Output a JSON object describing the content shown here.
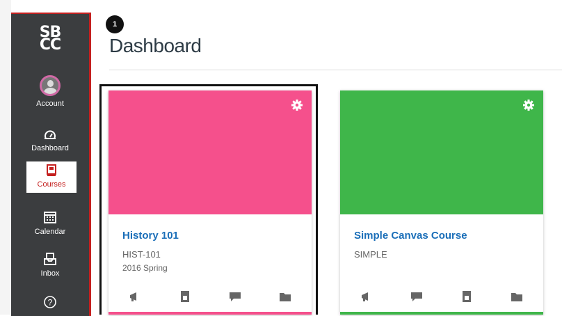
{
  "logo": {
    "line1": "SB",
    "line2": "CC"
  },
  "nav": {
    "items": [
      {
        "label": "Account",
        "icon": "avatar"
      },
      {
        "label": "Dashboard",
        "icon": "dashboard-icon"
      },
      {
        "label": "Courses",
        "icon": "courses-icon",
        "active": true
      },
      {
        "label": "Calendar",
        "icon": "calendar-icon"
      },
      {
        "label": "Inbox",
        "icon": "inbox-icon"
      },
      {
        "label": "",
        "icon": "help-icon"
      }
    ]
  },
  "step_badge": "1",
  "page": {
    "title": "Dashboard"
  },
  "cards": [
    {
      "name": "History 101",
      "code": "HIST-101",
      "term": "2016 Spring",
      "color": "#f5508c",
      "actions": [
        "announcement-icon",
        "assignments-icon",
        "discussions-icon",
        "files-icon"
      ]
    },
    {
      "name": "Simple Canvas Course",
      "code": "SIMPLE",
      "term": "",
      "color": "#3fb64a",
      "actions": [
        "announcement-icon",
        "discussions-icon",
        "assignments-icon",
        "files-icon"
      ]
    }
  ],
  "colors": {
    "nav_bg": "#3b3d3f",
    "accent": "#c4201f",
    "link": "#1a6eb8"
  }
}
